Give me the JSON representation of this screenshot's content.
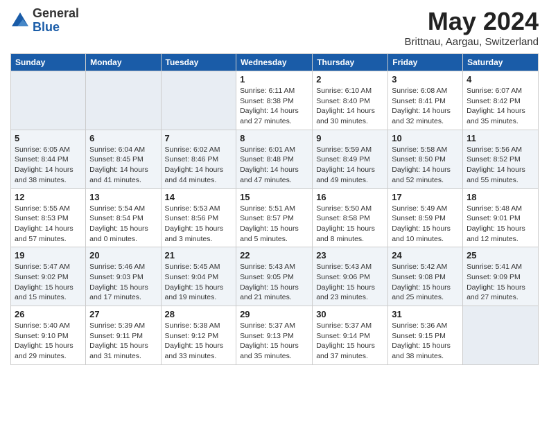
{
  "logo": {
    "general": "General",
    "blue": "Blue"
  },
  "title": "May 2024",
  "subtitle": "Brittnau, Aargau, Switzerland",
  "weekdays": [
    "Sunday",
    "Monday",
    "Tuesday",
    "Wednesday",
    "Thursday",
    "Friday",
    "Saturday"
  ],
  "weeks": [
    [
      {
        "day": "",
        "info": ""
      },
      {
        "day": "",
        "info": ""
      },
      {
        "day": "",
        "info": ""
      },
      {
        "day": "1",
        "info": "Sunrise: 6:11 AM\nSunset: 8:38 PM\nDaylight: 14 hours and 27 minutes."
      },
      {
        "day": "2",
        "info": "Sunrise: 6:10 AM\nSunset: 8:40 PM\nDaylight: 14 hours and 30 minutes."
      },
      {
        "day": "3",
        "info": "Sunrise: 6:08 AM\nSunset: 8:41 PM\nDaylight: 14 hours and 32 minutes."
      },
      {
        "day": "4",
        "info": "Sunrise: 6:07 AM\nSunset: 8:42 PM\nDaylight: 14 hours and 35 minutes."
      }
    ],
    [
      {
        "day": "5",
        "info": "Sunrise: 6:05 AM\nSunset: 8:44 PM\nDaylight: 14 hours and 38 minutes."
      },
      {
        "day": "6",
        "info": "Sunrise: 6:04 AM\nSunset: 8:45 PM\nDaylight: 14 hours and 41 minutes."
      },
      {
        "day": "7",
        "info": "Sunrise: 6:02 AM\nSunset: 8:46 PM\nDaylight: 14 hours and 44 minutes."
      },
      {
        "day": "8",
        "info": "Sunrise: 6:01 AM\nSunset: 8:48 PM\nDaylight: 14 hours and 47 minutes."
      },
      {
        "day": "9",
        "info": "Sunrise: 5:59 AM\nSunset: 8:49 PM\nDaylight: 14 hours and 49 minutes."
      },
      {
        "day": "10",
        "info": "Sunrise: 5:58 AM\nSunset: 8:50 PM\nDaylight: 14 hours and 52 minutes."
      },
      {
        "day": "11",
        "info": "Sunrise: 5:56 AM\nSunset: 8:52 PM\nDaylight: 14 hours and 55 minutes."
      }
    ],
    [
      {
        "day": "12",
        "info": "Sunrise: 5:55 AM\nSunset: 8:53 PM\nDaylight: 14 hours and 57 minutes."
      },
      {
        "day": "13",
        "info": "Sunrise: 5:54 AM\nSunset: 8:54 PM\nDaylight: 15 hours and 0 minutes."
      },
      {
        "day": "14",
        "info": "Sunrise: 5:53 AM\nSunset: 8:56 PM\nDaylight: 15 hours and 3 minutes."
      },
      {
        "day": "15",
        "info": "Sunrise: 5:51 AM\nSunset: 8:57 PM\nDaylight: 15 hours and 5 minutes."
      },
      {
        "day": "16",
        "info": "Sunrise: 5:50 AM\nSunset: 8:58 PM\nDaylight: 15 hours and 8 minutes."
      },
      {
        "day": "17",
        "info": "Sunrise: 5:49 AM\nSunset: 8:59 PM\nDaylight: 15 hours and 10 minutes."
      },
      {
        "day": "18",
        "info": "Sunrise: 5:48 AM\nSunset: 9:01 PM\nDaylight: 15 hours and 12 minutes."
      }
    ],
    [
      {
        "day": "19",
        "info": "Sunrise: 5:47 AM\nSunset: 9:02 PM\nDaylight: 15 hours and 15 minutes."
      },
      {
        "day": "20",
        "info": "Sunrise: 5:46 AM\nSunset: 9:03 PM\nDaylight: 15 hours and 17 minutes."
      },
      {
        "day": "21",
        "info": "Sunrise: 5:45 AM\nSunset: 9:04 PM\nDaylight: 15 hours and 19 minutes."
      },
      {
        "day": "22",
        "info": "Sunrise: 5:43 AM\nSunset: 9:05 PM\nDaylight: 15 hours and 21 minutes."
      },
      {
        "day": "23",
        "info": "Sunrise: 5:43 AM\nSunset: 9:06 PM\nDaylight: 15 hours and 23 minutes."
      },
      {
        "day": "24",
        "info": "Sunrise: 5:42 AM\nSunset: 9:08 PM\nDaylight: 15 hours and 25 minutes."
      },
      {
        "day": "25",
        "info": "Sunrise: 5:41 AM\nSunset: 9:09 PM\nDaylight: 15 hours and 27 minutes."
      }
    ],
    [
      {
        "day": "26",
        "info": "Sunrise: 5:40 AM\nSunset: 9:10 PM\nDaylight: 15 hours and 29 minutes."
      },
      {
        "day": "27",
        "info": "Sunrise: 5:39 AM\nSunset: 9:11 PM\nDaylight: 15 hours and 31 minutes."
      },
      {
        "day": "28",
        "info": "Sunrise: 5:38 AM\nSunset: 9:12 PM\nDaylight: 15 hours and 33 minutes."
      },
      {
        "day": "29",
        "info": "Sunrise: 5:37 AM\nSunset: 9:13 PM\nDaylight: 15 hours and 35 minutes."
      },
      {
        "day": "30",
        "info": "Sunrise: 5:37 AM\nSunset: 9:14 PM\nDaylight: 15 hours and 37 minutes."
      },
      {
        "day": "31",
        "info": "Sunrise: 5:36 AM\nSunset: 9:15 PM\nDaylight: 15 hours and 38 minutes."
      },
      {
        "day": "",
        "info": ""
      }
    ]
  ]
}
